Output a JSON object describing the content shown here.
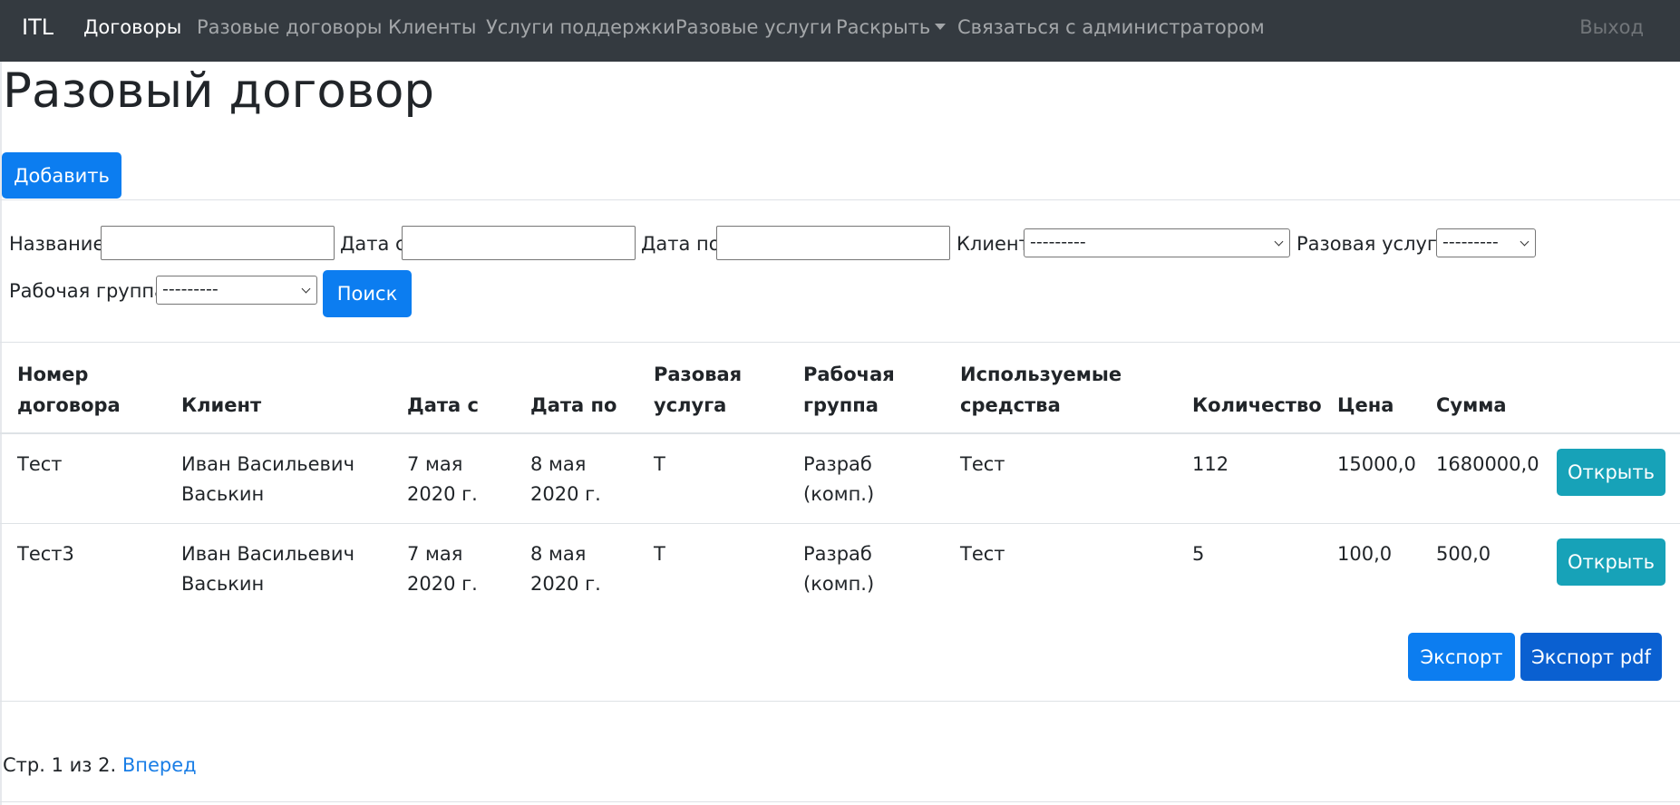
{
  "nav": {
    "brand": "ITL",
    "items": [
      {
        "label": "Договоры",
        "active": true
      },
      {
        "label": "Разовые договоры"
      },
      {
        "label": "Клиенты"
      },
      {
        "label": "Услуги поддержки"
      },
      {
        "label": "Разовые услуги"
      },
      {
        "label": "Раскрыть",
        "dropdown": true
      },
      {
        "label": "Связаться с администратором"
      }
    ],
    "logout": "Выход"
  },
  "page": {
    "title": "Разовый договор",
    "add_label": "Добавить"
  },
  "filters": {
    "name_label": "Название:",
    "name_value": "",
    "date_from_label": "Дата с:",
    "date_from_value": "",
    "date_to_label": "Дата по:",
    "date_to_value": "",
    "client_label": "Клиент:",
    "client_value": "---------",
    "service_label": "Разовая услуга:",
    "service_value": "---------",
    "group_label": "Рабочая группа:",
    "group_value": "---------",
    "search_label": "Поиск"
  },
  "table": {
    "headers": {
      "number": [
        "Номер",
        "договора"
      ],
      "client": "Клиент",
      "date_from": "Дата с",
      "date_to": "Дата по",
      "service": [
        "Разовая",
        "услуга"
      ],
      "group": [
        "Рабочая",
        "группа"
      ],
      "resources": [
        "Используемые",
        "средства"
      ],
      "quantity": "Количество",
      "price": "Цена",
      "sum": "Сумма"
    },
    "rows": [
      {
        "number": "Тест",
        "client": [
          "Иван Васильевич",
          "Васькин"
        ],
        "date_from": [
          "7 мая",
          "2020 г."
        ],
        "date_to": [
          "8 мая",
          "2020 г."
        ],
        "service": "Т",
        "group": [
          "Разраб",
          "(комп.)"
        ],
        "resources": "Тест",
        "quantity": "112",
        "price": "15000,0",
        "sum": "1680000,0",
        "open_label": "Открыть"
      },
      {
        "number": "Тест3",
        "client": [
          "Иван Васильевич",
          "Васькин"
        ],
        "date_from": [
          "7 мая",
          "2020 г."
        ],
        "date_to": [
          "8 мая",
          "2020 г."
        ],
        "service": "Т",
        "group": [
          "Разраб",
          "(комп.)"
        ],
        "resources": "Тест",
        "quantity": "5",
        "price": "100,0",
        "sum": "500,0",
        "open_label": "Открыть"
      }
    ]
  },
  "export": {
    "export_label": "Экспорт",
    "export_pdf_label": "Экспорт pdf"
  },
  "pagination": {
    "text": "Стр. 1 из 2.",
    "next_label": "Вперед"
  }
}
